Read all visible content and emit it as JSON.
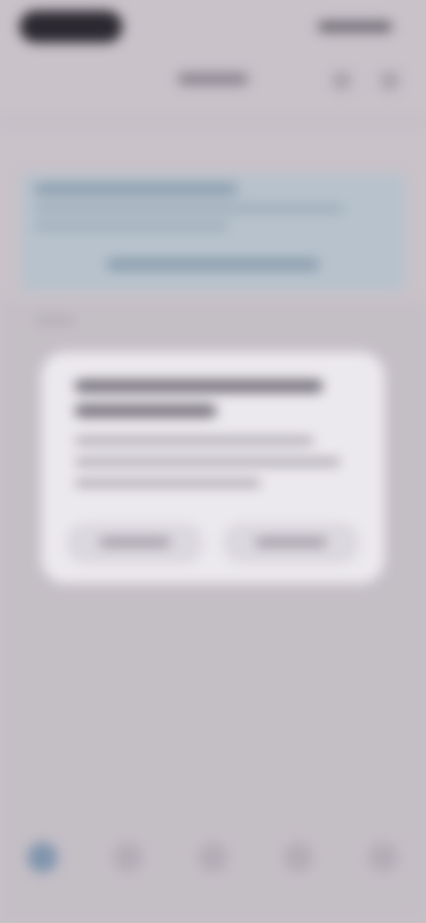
{
  "theme": {
    "background": "#c9c2c9",
    "banner": "#b7c2cc",
    "dialog": "#ece9ee",
    "accent": "#7f95ad"
  },
  "icons": {
    "back": "back-icon",
    "share": "share-icon",
    "more": "more-icon",
    "home": "home-icon",
    "search": "search-icon",
    "add": "add-icon",
    "activity": "activity-icon",
    "profile": "profile-icon"
  }
}
